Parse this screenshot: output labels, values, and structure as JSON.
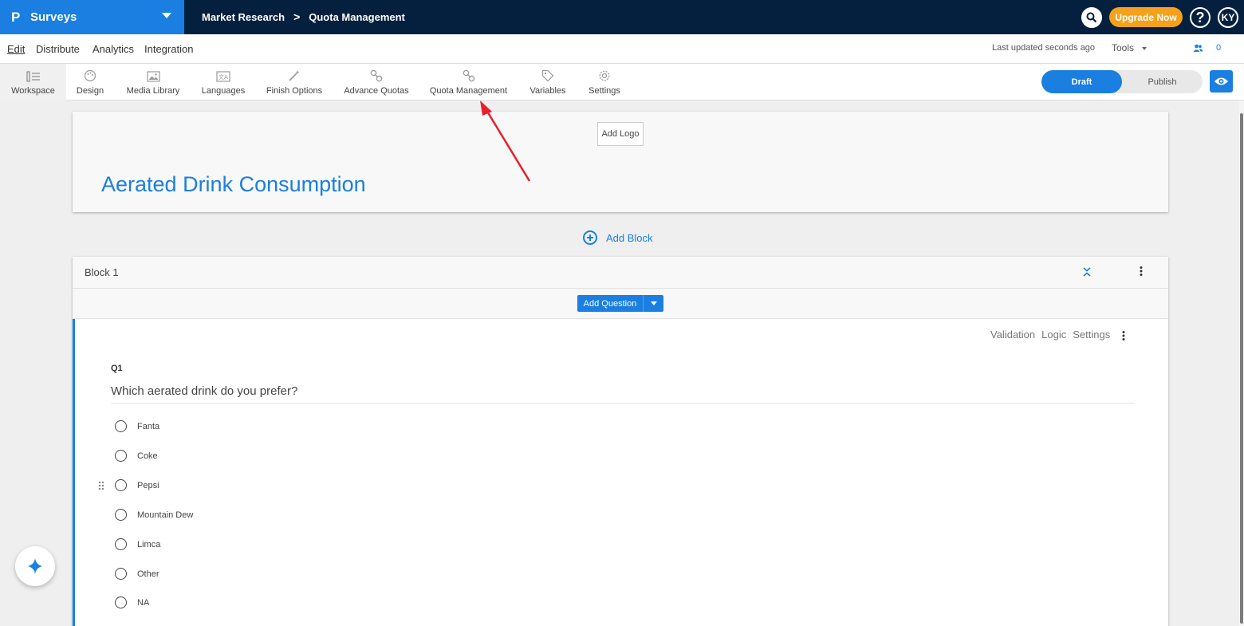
{
  "app": {
    "name": "Surveys",
    "logo_glyph": "P"
  },
  "breadcrumb": {
    "parent": "Market Research",
    "separator": ">",
    "current": "Quota Management"
  },
  "topbar": {
    "upgrade_label": "Upgrade Now",
    "help_glyph": "?",
    "avatar_initials": "KY"
  },
  "menu": {
    "edit": "Edit",
    "distribute": "Distribute",
    "analytics": "Analytics",
    "integration": "Integration"
  },
  "status": {
    "last_updated": "Last updated seconds ago",
    "tools": "Tools",
    "collaborators": "0"
  },
  "toolbar": {
    "workspace": "Workspace",
    "design": "Design",
    "media_library": "Media Library",
    "languages": "Languages",
    "finish_options": "Finish Options",
    "advance_quotas": "Advance Quotas",
    "quota_management": "Quota Management",
    "variables": "Variables",
    "settings": "Settings"
  },
  "mode": {
    "draft": "Draft",
    "publish": "Publish",
    "selected": "Draft"
  },
  "survey": {
    "add_logo": "Add Logo",
    "title": "Aerated Drink Consumption",
    "add_block": "Add Block"
  },
  "block": {
    "title": "Block 1",
    "add_question": "Add Question",
    "question": {
      "actions": {
        "validation": "Validation",
        "logic": "Logic",
        "settings": "Settings"
      },
      "number": "Q1",
      "text": "Which aerated drink do you prefer?",
      "options": [
        "Fanta",
        "Coke",
        "Pepsi",
        "Mountain Dew",
        "Limca",
        "Other",
        "NA"
      ]
    }
  },
  "colors": {
    "brand": "#1a7fe0",
    "topbar": "#05203f",
    "upgrade": "#f6a11a",
    "annotation_arrow": "#e8202a"
  }
}
